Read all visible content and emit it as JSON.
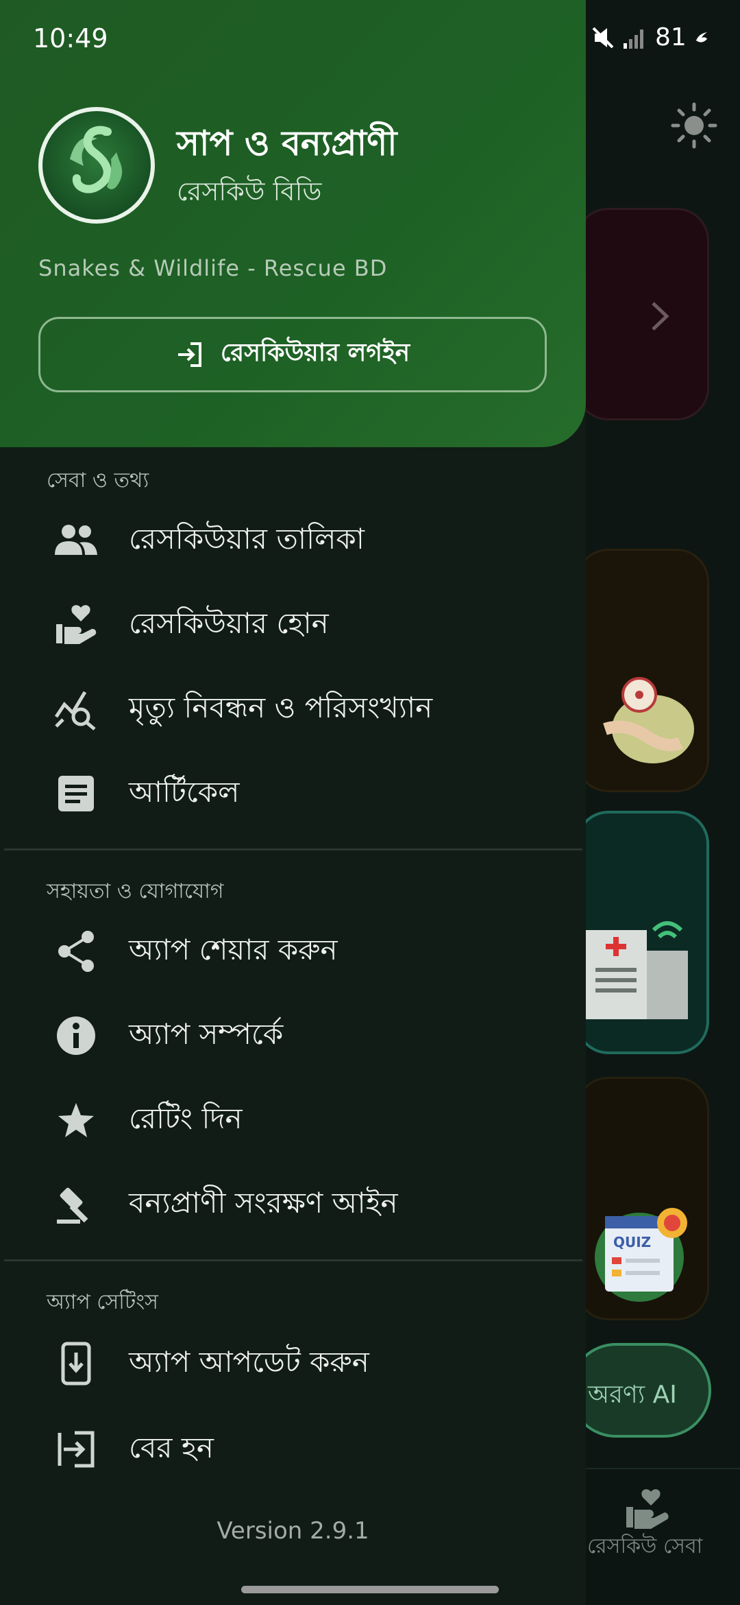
{
  "status_bar": {
    "time": "10:49",
    "battery": "81"
  },
  "drawer": {
    "app_title": "সাপ ও বন্যপ্রাণী",
    "app_subtitle": "রেসকিউ বিডি",
    "app_name_en": "Snakes & Wildlife - Rescue BD",
    "login_label": "রেসকিউয়ার লগইন",
    "sections": [
      {
        "title": "সেবা ও তথ্য",
        "items": [
          {
            "label": "রেসকিউয়ার তালিকা",
            "icon": "group-icon"
          },
          {
            "label": "রেসকিউয়ার হোন",
            "icon": "volunteer-icon"
          },
          {
            "label": "মৃত্যু নিবন্ধন ও পরিসংখ্যান",
            "icon": "analytics-search-icon"
          },
          {
            "label": "আর্টিকেল",
            "icon": "article-icon"
          }
        ]
      },
      {
        "title": "সহায়তা ও যোগাযোগ",
        "items": [
          {
            "label": "অ্যাপ শেয়ার করুন",
            "icon": "share-icon"
          },
          {
            "label": "অ্যাপ সম্পর্কে",
            "icon": "info-icon"
          },
          {
            "label": "রেটিং দিন",
            "icon": "star-icon"
          },
          {
            "label": "বন্যপ্রাণী সংরক্ষণ আইন",
            "icon": "gavel-icon"
          }
        ]
      },
      {
        "title": "অ্যাপ সেটিংস",
        "items": [
          {
            "label": "অ্যাপ আপডেট করুন",
            "icon": "system-update-icon"
          },
          {
            "label": "বের হন",
            "icon": "logout-icon"
          }
        ]
      }
    ],
    "version": "Version 2.9.1"
  },
  "background": {
    "ai_button_label": "অরণ্য AI",
    "bottom_nav_label": "রেসকিউ সেবা"
  },
  "colors": {
    "drawer_header": "#1e6125",
    "drawer_body": "#111c16",
    "accent": "#3a8f63"
  }
}
